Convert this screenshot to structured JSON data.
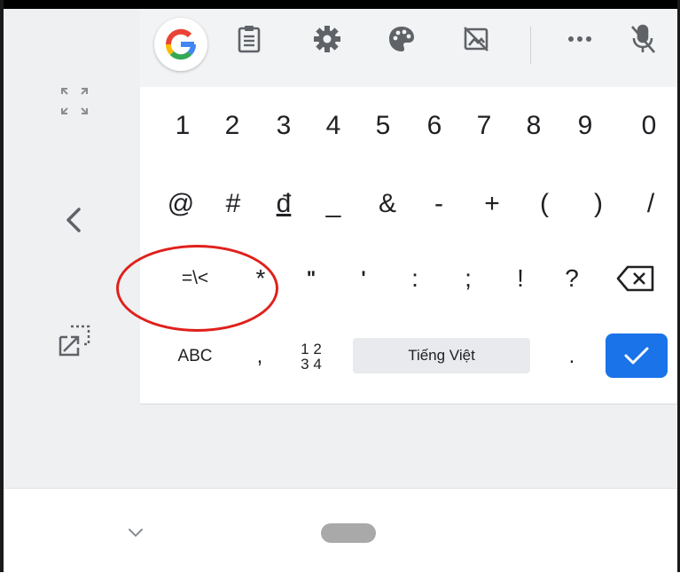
{
  "toolbar": {
    "icons": [
      "google-g-icon",
      "clipboard-icon",
      "settings-gear-icon",
      "palette-icon",
      "no-image-icon",
      "more-icon",
      "mic-off-icon"
    ],
    "brand_colors": {
      "blue": "#4285F4",
      "red": "#EA4335",
      "yellow": "#FBBC05",
      "green": "#34A853"
    }
  },
  "side_panel": {
    "icons": [
      "expand-icon",
      "back-chevron-icon",
      "floating-keyboard-icon"
    ]
  },
  "keyboard": {
    "row1": [
      "1",
      "2",
      "3",
      "4",
      "5",
      "6",
      "7",
      "8",
      "9",
      "0"
    ],
    "row2": [
      "@",
      "#",
      "đ",
      "_",
      "&",
      "-",
      "+",
      "(",
      ")",
      "/"
    ],
    "row3": [
      "=\\<",
      "*",
      "\"",
      "'",
      ":",
      ";",
      "!",
      "?"
    ],
    "row4": {
      "abc": "ABC",
      "comma": ",",
      "numpad_top": "1 2",
      "numpad_bottom": "3 4",
      "space": "Tiếng Việt",
      "period": "."
    },
    "enter_color": "#1a73e8",
    "delete_icon": "backspace-icon"
  },
  "annotation": {
    "color": "#e0201b",
    "target": "=\\< and * keys"
  },
  "nav": {
    "icons": [
      "hide-keyboard-chevron-icon",
      "home-pill"
    ]
  }
}
